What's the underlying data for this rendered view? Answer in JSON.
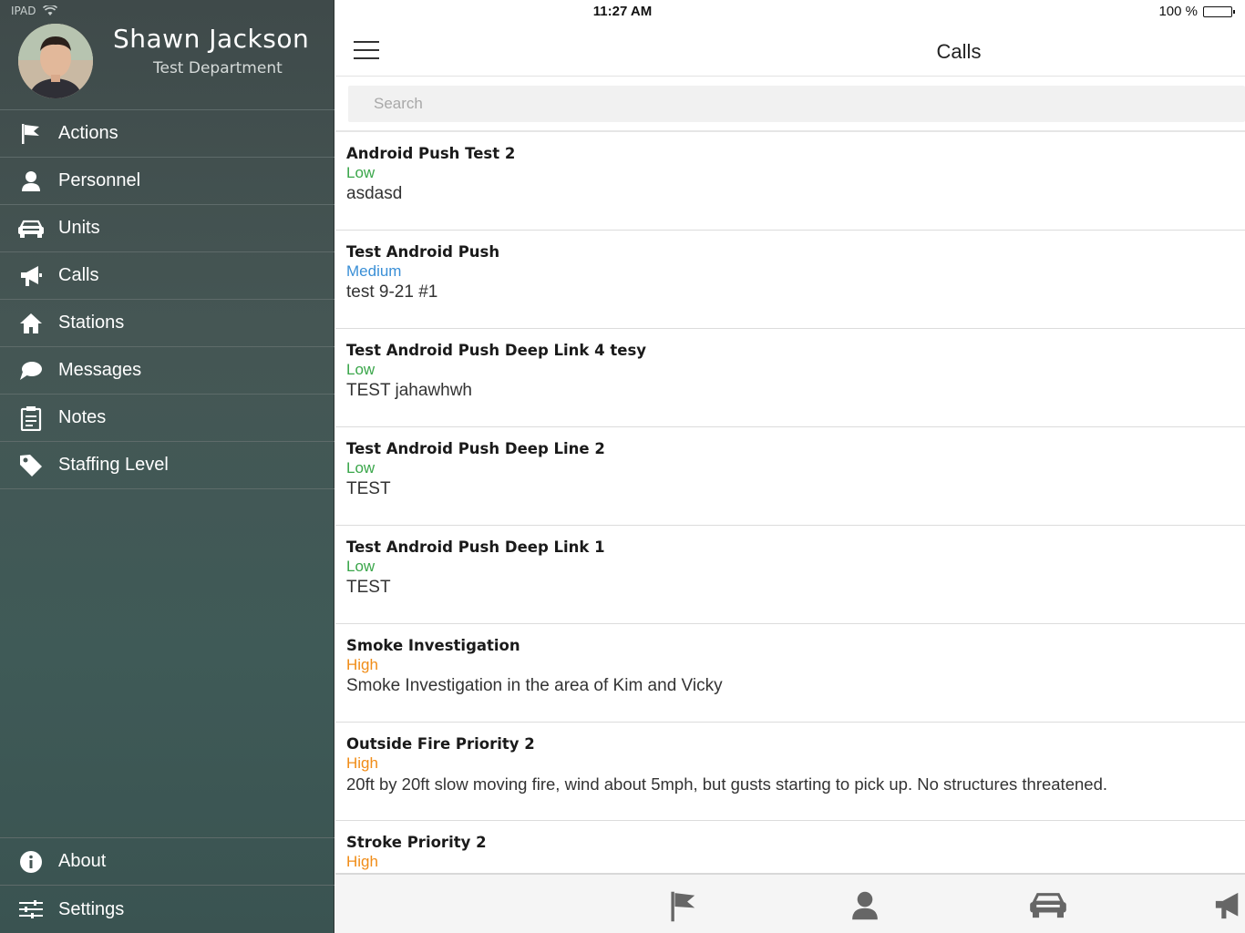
{
  "status": {
    "device": "IPAD",
    "time": "11:27 AM",
    "battery": "100 %"
  },
  "profile": {
    "name": "Shawn Jackson",
    "department": "Test Department"
  },
  "nav": {
    "items": [
      {
        "label": "Actions",
        "icon": "flag-icon"
      },
      {
        "label": "Personnel",
        "icon": "person-icon"
      },
      {
        "label": "Units",
        "icon": "car-icon"
      },
      {
        "label": "Calls",
        "icon": "megaphone-icon"
      },
      {
        "label": "Stations",
        "icon": "home-icon"
      },
      {
        "label": "Messages",
        "icon": "chat-icon"
      },
      {
        "label": "Notes",
        "icon": "clipboard-icon"
      },
      {
        "label": "Staffing Level",
        "icon": "tag-icon"
      }
    ],
    "bottom": [
      {
        "label": "About",
        "icon": "info-icon"
      },
      {
        "label": "Settings",
        "icon": "sliders-icon"
      }
    ]
  },
  "header": {
    "title": "Calls"
  },
  "search": {
    "placeholder": "Search",
    "value": ""
  },
  "colors": {
    "low": "#3aa64a",
    "medium": "#3a8fd6",
    "high": "#f08c17"
  },
  "calls": [
    {
      "name": "Android Push Test 2",
      "priority": "Low",
      "level": "low",
      "description": "asdasd"
    },
    {
      "name": "Test Android Push",
      "priority": "Medium",
      "level": "medium",
      "description": "test 9-21 #1"
    },
    {
      "name": "Test Android Push Deep Link 4 tesy",
      "priority": "Low",
      "level": "low",
      "description": "TEST jahawhwh"
    },
    {
      "name": "Test Android Push Deep Line 2",
      "priority": "Low",
      "level": "low",
      "description": "TEST"
    },
    {
      "name": "Test Android Push Deep Link 1",
      "priority": "Low",
      "level": "low",
      "description": "TEST"
    },
    {
      "name": "Smoke Investigation",
      "priority": "High",
      "level": "high",
      "description": "Smoke Investigation in the area of Kim and Vicky"
    },
    {
      "name": "Outside Fire Priority 2",
      "priority": "High",
      "level": "high",
      "description": "20ft by 20ft slow moving fire, wind about 5mph, but gusts starting to pick up. No structures threatened."
    },
    {
      "name": "Stroke Priority 2",
      "priority": "High",
      "level": "high",
      "description": ""
    }
  ],
  "tabbar": {
    "tabs": [
      "flag-icon",
      "person-icon",
      "car-icon",
      "megaphone-icon"
    ]
  }
}
